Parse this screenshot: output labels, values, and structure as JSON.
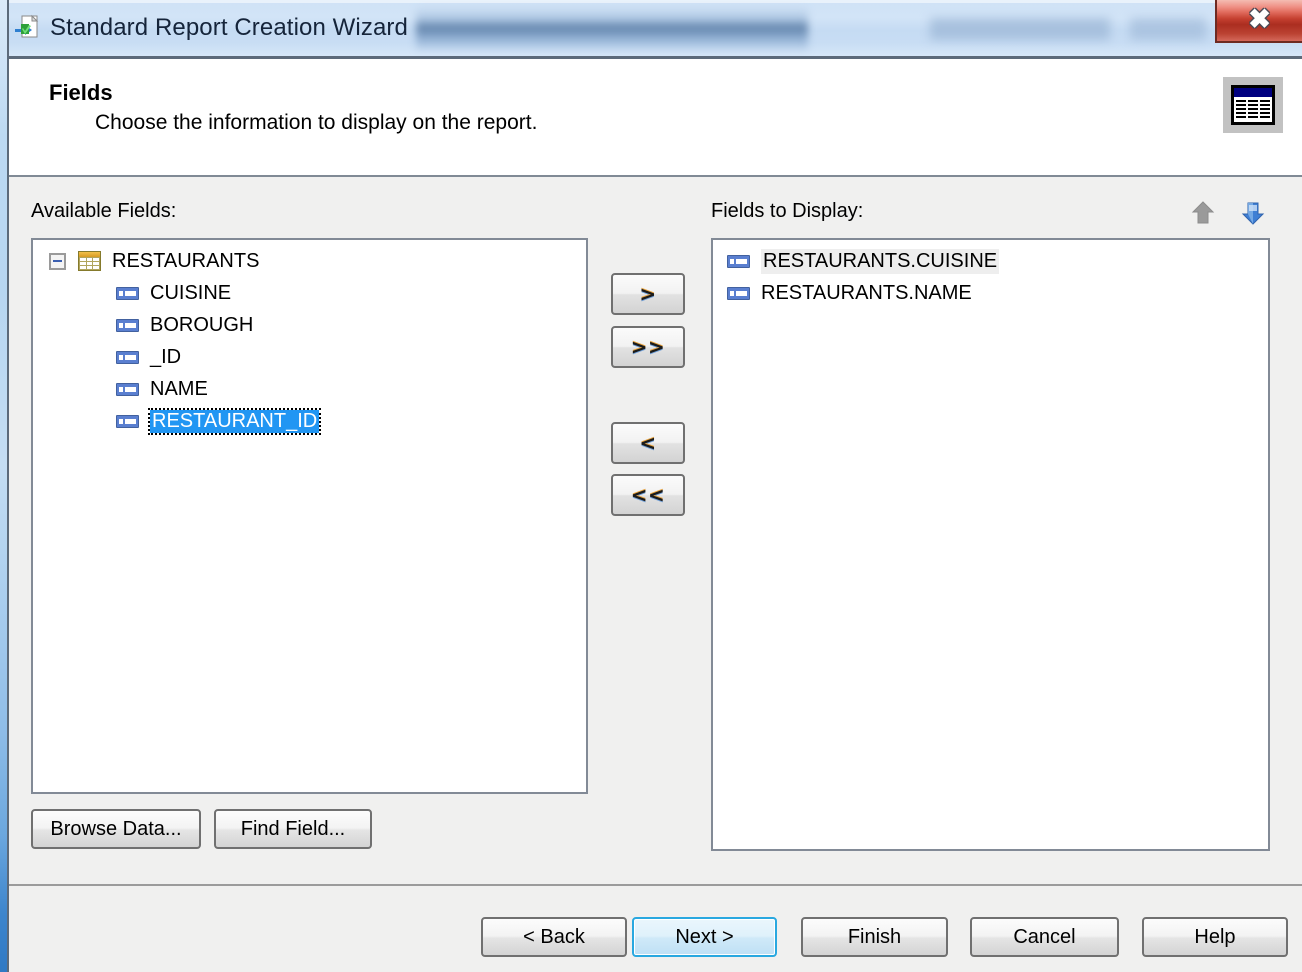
{
  "window": {
    "title": "Standard Report Creation Wizard",
    "app_icon": "report-wizard-icon",
    "close_label": "✖"
  },
  "header": {
    "title": "Fields",
    "subtitle": "Choose the information to display on the report.",
    "icon": "report-preview-icon"
  },
  "panels": {
    "available": {
      "label": "Available Fields:",
      "tree": {
        "root": {
          "label": "RESTAURANTS",
          "icon": "table-icon",
          "expanded": true,
          "expander_glyph": "−"
        },
        "children": [
          {
            "label": "CUISINE",
            "icon": "field-icon",
            "selected": false
          },
          {
            "label": "BOROUGH",
            "icon": "field-icon",
            "selected": false
          },
          {
            "label": "_ID",
            "icon": "field-icon",
            "selected": false
          },
          {
            "label": "NAME",
            "icon": "field-icon",
            "selected": false
          },
          {
            "label": "RESTAURANT_ID",
            "icon": "field-icon",
            "selected": true
          }
        ]
      },
      "buttons": {
        "browse_data": "Browse Data...",
        "find_field": "Find Field..."
      }
    },
    "display": {
      "label": "Fields to Display:",
      "order_arrows": {
        "up": "move-up-arrow-icon",
        "down": "move-down-arrow-icon"
      },
      "items": [
        {
          "label": "RESTAURANTS.CUISINE",
          "icon": "field-icon",
          "highlighted": true
        },
        {
          "label": "RESTAURANTS.NAME",
          "icon": "field-icon",
          "highlighted": false
        }
      ]
    }
  },
  "transfer_buttons": {
    "add": ">",
    "add_all": ">>",
    "remove": "<",
    "remove_all": "<<"
  },
  "footer_buttons": {
    "back": "< Back",
    "next": "Next >",
    "finish": "Finish",
    "cancel": "Cancel",
    "help": "Help"
  },
  "colors": {
    "titlebar_glass": "#c8ddf4",
    "close_red": "#c43f2f",
    "selection_blue": "#2196f3",
    "default_button_blue": "#29a8e0",
    "dialog_gray": "#f0f0ef",
    "border_gray": "#828a96",
    "table_icon_gold": "#d79a22",
    "field_icon_blue": "#5a7fd0",
    "report_icon_navy": "#000080"
  }
}
